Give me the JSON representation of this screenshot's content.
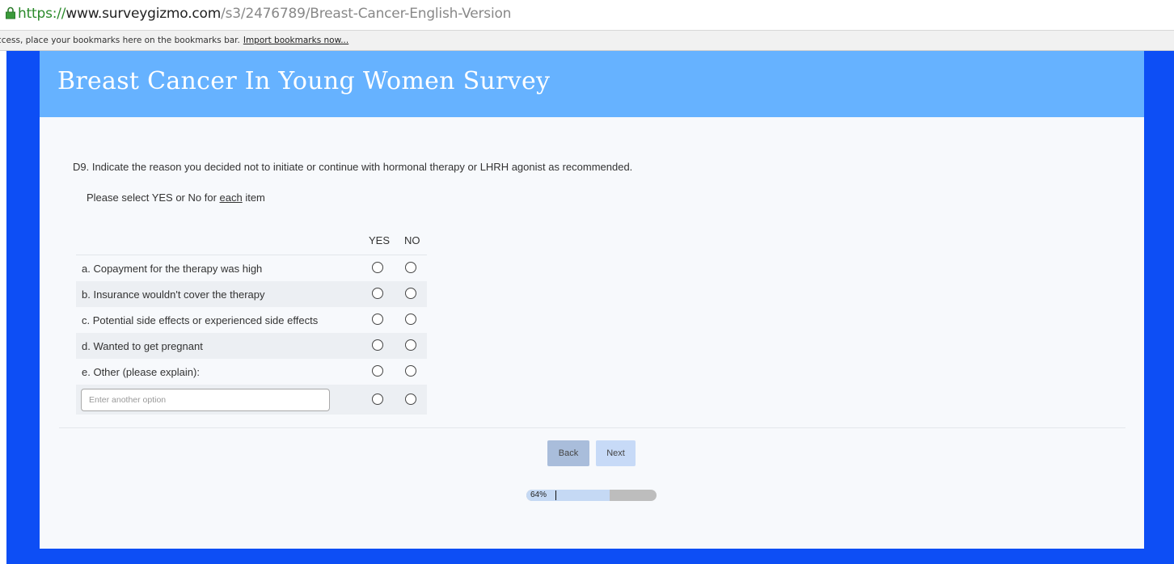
{
  "browser": {
    "url_protocol": "https://",
    "url_host": "www.surveygizmo.com",
    "url_path": "/s3/2476789/Breast-Cancer-English-Version",
    "bookmarks_message": "ccess, place your bookmarks here on the bookmarks bar.",
    "bookmarks_link": "Import bookmarks now..."
  },
  "survey": {
    "title": "Breast Cancer In Young Women Survey",
    "question": "D9.  Indicate the reason you decided not to initiate or continue with hormonal therapy or LHRH agonist as recommended.",
    "instruction_before": "Please select YES or No for ",
    "instruction_emphasis": "each",
    "instruction_after": " item",
    "columns": {
      "yes": "YES",
      "no": "NO"
    },
    "rows": [
      {
        "label": "a. Copayment for the therapy was high"
      },
      {
        "label": "b. Insurance wouldn't cover the therapy"
      },
      {
        "label": "c. Potential side effects or experienced side effects"
      },
      {
        "label": "d. Wanted to get pregnant"
      },
      {
        "label": "e. Other (please explain):"
      }
    ],
    "other_input": {
      "placeholder": "Enter another option",
      "value": ""
    },
    "buttons": {
      "back": "Back",
      "next": "Next"
    },
    "progress": {
      "label": "64%",
      "value": 0.64
    }
  },
  "colors": {
    "frame": "#0d4ef5",
    "header": "#66b2ff",
    "back_button": "#a9bddb",
    "next_button": "#c7daf7"
  }
}
